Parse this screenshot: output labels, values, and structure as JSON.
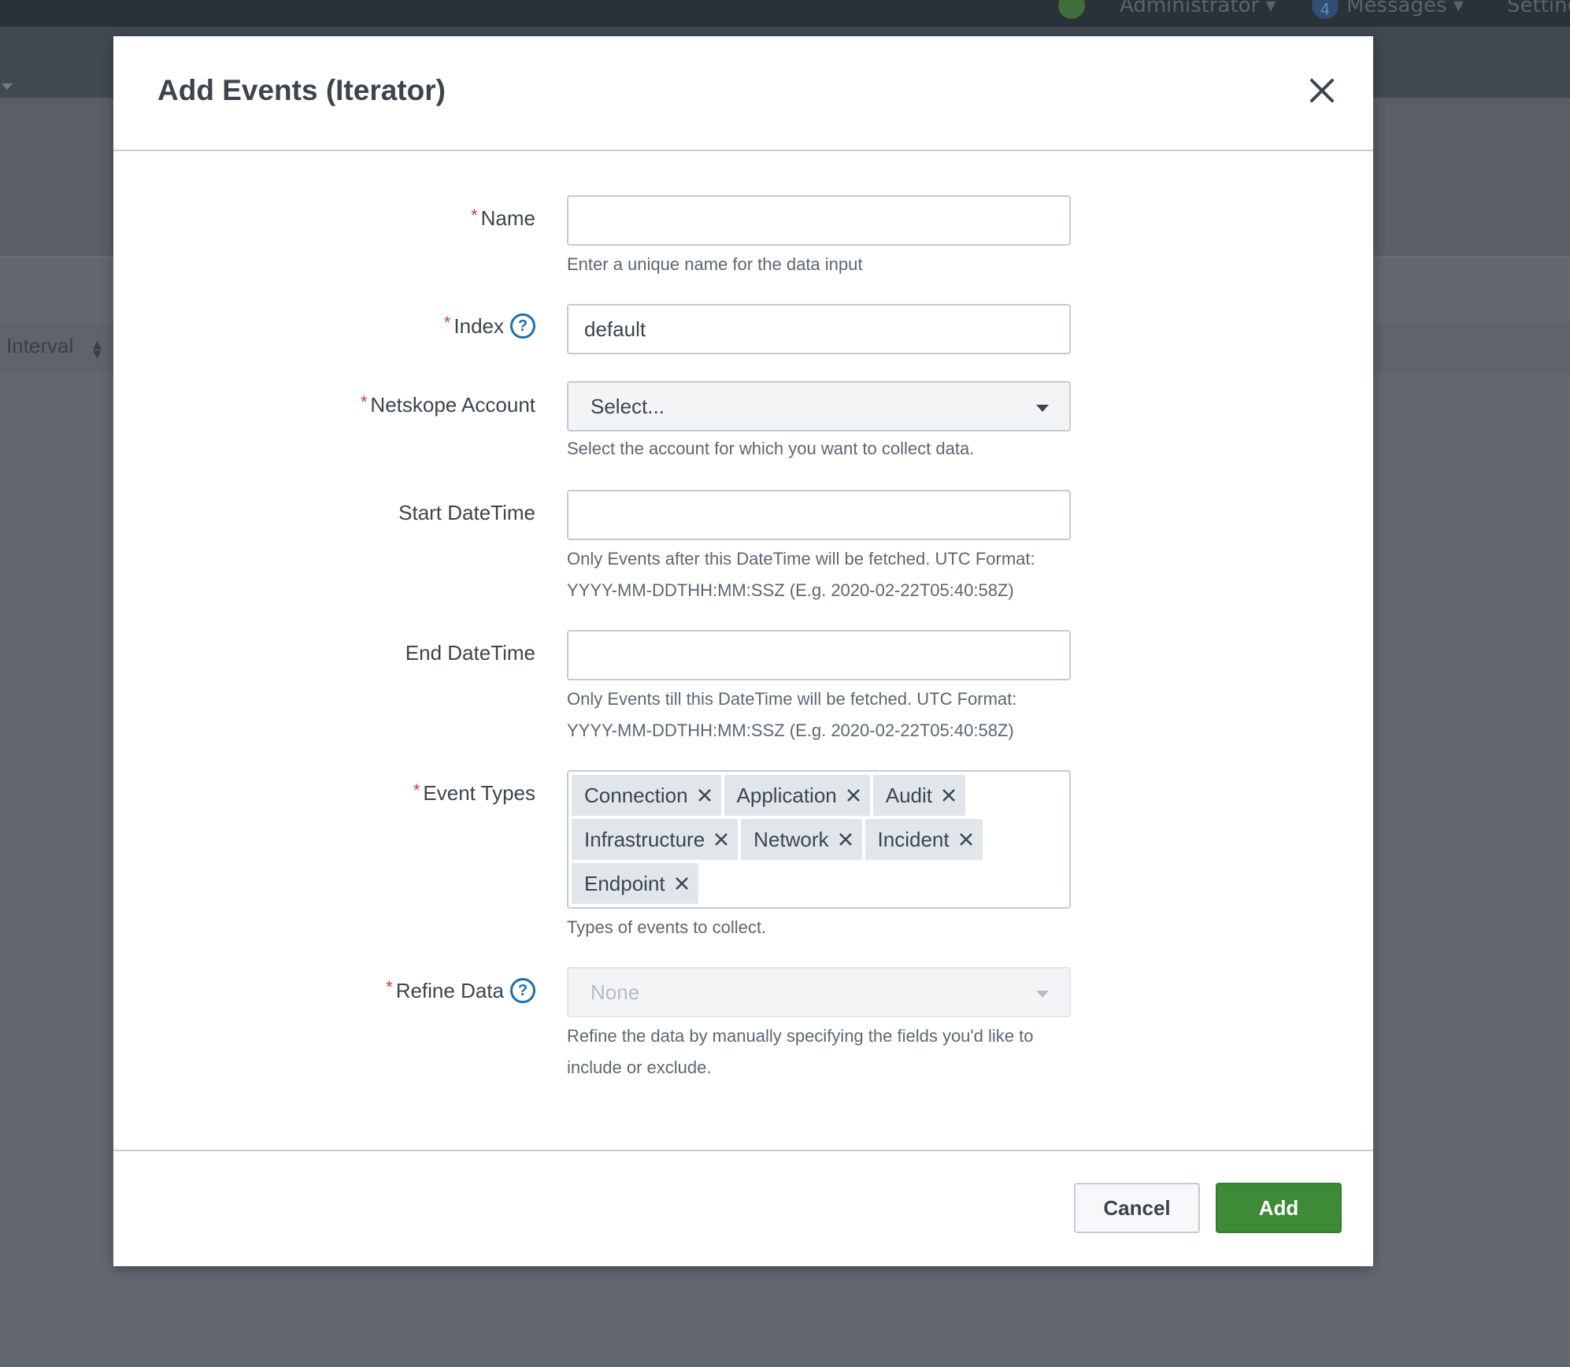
{
  "background": {
    "topbar": {
      "user_menu": "Administrator ▾",
      "messages_count": "4",
      "messages_menu": "Messages ▾",
      "settings_menu": "Settings"
    },
    "table": {
      "column_interval": "Interval"
    }
  },
  "modal": {
    "title": "Add Events (Iterator)",
    "fields": {
      "name": {
        "label": "Name",
        "required": true,
        "value": "",
        "help": "Enter a unique name for the data input"
      },
      "index": {
        "label": "Index",
        "required": true,
        "value": "default"
      },
      "account": {
        "label": "Netskope Account",
        "required": true,
        "value": "Select...",
        "help": "Select the account for which you want to collect data."
      },
      "start": {
        "label": "Start DateTime",
        "required": false,
        "value": "",
        "help_line1": "Only Events after this DateTime will be fetched. UTC Format:",
        "help_line2": "YYYY-MM-DDTHH:MM:SSZ (E.g. 2020-02-22T05:40:58Z)"
      },
      "end": {
        "label": "End DateTime",
        "required": false,
        "value": "",
        "help_line1": "Only Events till this DateTime will be fetched. UTC Format:",
        "help_line2": "YYYY-MM-DDTHH:MM:SSZ (E.g. 2020-02-22T05:40:58Z)"
      },
      "event_types": {
        "label": "Event Types",
        "required": true,
        "selected": [
          "Connection",
          "Application",
          "Audit",
          "Infrastructure",
          "Network",
          "Incident",
          "Endpoint"
        ],
        "help": "Types of events to collect."
      },
      "refine": {
        "label": "Refine Data",
        "required": true,
        "value": "None",
        "disabled": true,
        "help_line1": "Refine the data by manually specifying the fields you'd like to",
        "help_line2": "include or exclude."
      }
    },
    "required_marker": "*",
    "help_icon_glyph": "?",
    "buttons": {
      "cancel": "Cancel",
      "add": "Add"
    }
  },
  "colors": {
    "primary_button": "#3d8b37",
    "required_asterisk": "#d6363f",
    "help_icon": "#1a6fb0",
    "overlay": "#636770"
  }
}
